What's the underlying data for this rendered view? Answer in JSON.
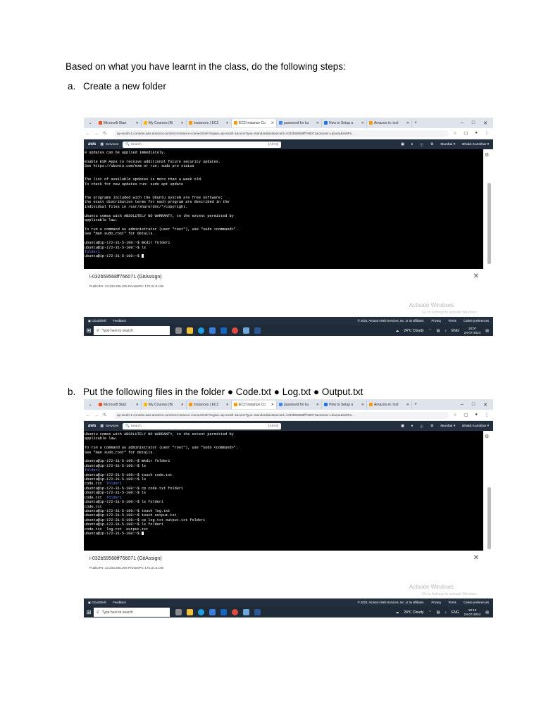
{
  "document": {
    "intro": "Based on what you have learnt in the class, do the following steps:",
    "step_a": {
      "marker": "a.",
      "text": "Create a new folder"
    },
    "step_b": {
      "marker": "b.",
      "text": "Put the following files in the folder ● Code.txt ● Log.txt ● Output.txt"
    }
  },
  "browser": {
    "tabs": [
      {
        "label": "Microsoft Start",
        "color": "#f25022"
      },
      {
        "label": "My Courses (Bi",
        "color": "#ffb900"
      },
      {
        "label": "Instances | EC2",
        "color": "#ff9900"
      },
      {
        "label": "EC2 Instance Co",
        "color": "#ff9900"
      },
      {
        "label": "password for ku",
        "color": "#4285f4"
      },
      {
        "label": "How to Setup a",
        "color": "#1a73e8"
      },
      {
        "label": "Amazon.in: tool",
        "color": "#ff9900"
      }
    ],
    "url": "ap-south-1.console.aws.amazon.com/ec2-instance-connect/ssh?region=ap-south-1&connType=standard&instanceId=i-032b59568ff766071&osUser=ubuntu&sshPo...",
    "new_tab": "+",
    "win_min": "–",
    "win_max": "□",
    "win_close": "✕"
  },
  "aws": {
    "logo": "aws",
    "services": "Services",
    "search_placeholder": "Search",
    "search_shortcut": "[Alt+S]",
    "region": "Mumbai ▾",
    "user": "Bhakti Kumbhar ▾"
  },
  "terminal1": {
    "lines": [
      {
        "text": "0 updates can be applied immediately."
      },
      {
        "text": ""
      },
      {
        "text": "Enable ESM Apps to receive additional future security updates."
      },
      {
        "text": "See https://ubuntu.com/esm or run: sudo pro status"
      },
      {
        "text": ""
      },
      {
        "text": ""
      },
      {
        "text": "The list of available updates is more than a week old."
      },
      {
        "text": "To check for new updates run: sudo apt update"
      },
      {
        "text": ""
      },
      {
        "text": ""
      },
      {
        "text": "The programs included with the Ubuntu system are free software;"
      },
      {
        "text": "the exact distribution terms for each program are described in the"
      },
      {
        "text": "individual files in /usr/share/doc/*/copyright."
      },
      {
        "text": ""
      },
      {
        "text": "Ubuntu comes with ABSOLUTELY NO WARRANTY, to the extent permitted by"
      },
      {
        "text": "applicable law."
      },
      {
        "text": ""
      },
      {
        "text": "To run a command as administrator (user \"root\"), use \"sudo <command>\"."
      },
      {
        "text": "See \"man sudo_root\" for details."
      },
      {
        "text": ""
      },
      {
        "text": "ubuntu@ip-172-31-5-100:~$ mkdir folder1"
      },
      {
        "text": "ubuntu@ip-172-31-5-100:~$ ls"
      },
      {
        "text": "folder1",
        "blue": true
      },
      {
        "text": "ubuntu@ip-172-31-5-100:~$ ",
        "cursor": true
      }
    ]
  },
  "terminal2": {
    "lines": [
      {
        "text": "Ubuntu comes with ABSOLUTELY NO WARRANTY, to the extent permitted by"
      },
      {
        "text": "applicable law."
      },
      {
        "text": ""
      },
      {
        "text": "To run a command as administrator (user \"root\"), use \"sudo <command>\"."
      },
      {
        "text": "See \"man sudo_root\" for details."
      },
      {
        "text": ""
      },
      {
        "text": "ubuntu@ip-172-31-5-100:~$ mkdir folder1"
      },
      {
        "text": "ubuntu@ip-172-31-5-100:~$ ls"
      },
      {
        "text": "folder1",
        "blue": true
      },
      {
        "text": "ubuntu@ip-172-31-5-100:~$ touch code.txt"
      },
      {
        "text": "ubuntu@ip-172-31-5-100:~$ ls"
      },
      {
        "text": "code.txt  ",
        "tail_blue": "folder1"
      },
      {
        "text": "ubuntu@ip-172-31-5-100:~$ cp code.txt folder1"
      },
      {
        "text": "ubuntu@ip-172-31-5-100:~$ ls"
      },
      {
        "text": "code.txt  ",
        "tail_blue": "folder1"
      },
      {
        "text": "ubuntu@ip-172-31-5-100:~$ ls folder1"
      },
      {
        "text": "code.txt"
      },
      {
        "text": "ubuntu@ip-172-31-5-100:~$ touch log.txt"
      },
      {
        "text": "ubuntu@ip-172-31-5-100:~$ touch output.txt"
      },
      {
        "text": "ubuntu@ip-172-31-5-100:~$ cp log.txt output.txt folder1"
      },
      {
        "text": "ubuntu@ip-172-31-5-100:~$ ls folder1"
      },
      {
        "text": "code.txt  log.txt  output.txt"
      },
      {
        "text": "ubuntu@ip-172-31-5-100:~$ ",
        "cursor": true
      }
    ]
  },
  "instance": {
    "id": "i-032b59568ff766071 (GitAssign)",
    "ips": "PublicIPs: 13.233.255.209   PrivateIPs: 172.31.5.100",
    "close": "✕",
    "activate": "Activate Windows",
    "activate_sub": "Go to Settings to activate Windows."
  },
  "aws_footer": {
    "cloudshell": "CloudShell",
    "feedback": "Feedback",
    "copyright": "© 2024, Amazon Web Services, Inc. or its affiliates.",
    "privacy": "Privacy",
    "terms": "Terms",
    "cookies": "Cookie preferences"
  },
  "taskbar": {
    "search_placeholder": "Type here to search",
    "weather": "24°C  Cloudy",
    "lang": "ENG",
    "time1": "18:07",
    "time2": "18:10",
    "date": "24-07-2024"
  }
}
